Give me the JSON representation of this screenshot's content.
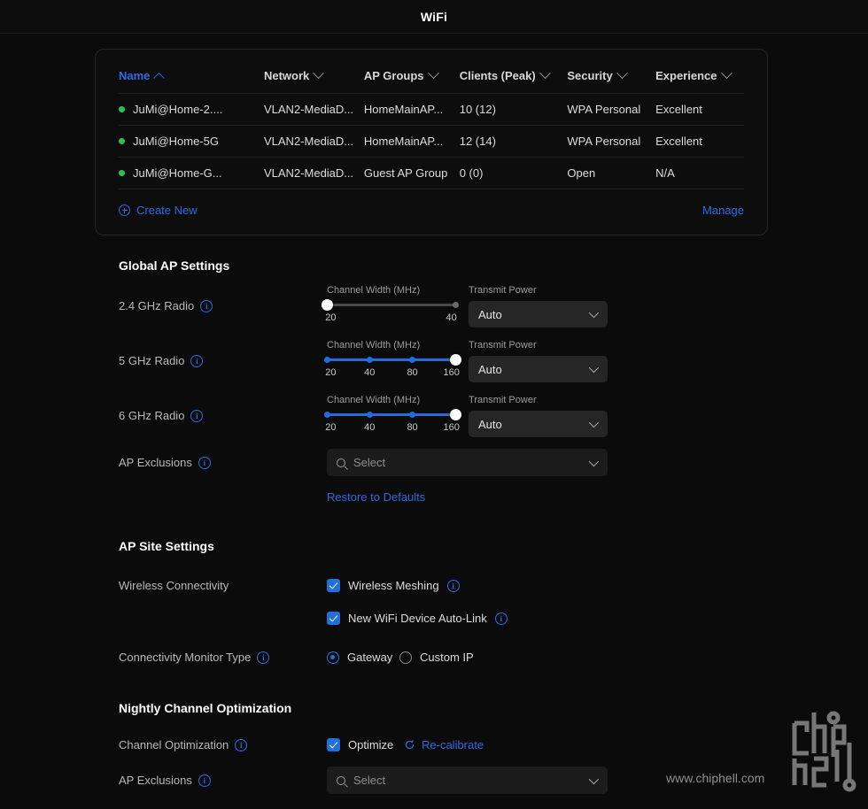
{
  "header": {
    "title": "WiFi"
  },
  "colors": {
    "accent": "#2d6be4",
    "slider_active": "#1f6fdc",
    "status_dot": "#31c04e",
    "experience_good": "#24a244",
    "page_bg": "#0b0b0b",
    "card_bg": "#0d0d0d",
    "field_bg": "#262626"
  },
  "wifi_table": {
    "columns": [
      {
        "label": "Name",
        "sorted": true,
        "sort_dir": "asc"
      },
      {
        "label": "Network",
        "sorted": false,
        "sort_dir": "none"
      },
      {
        "label": "AP Groups",
        "sorted": false,
        "sort_dir": "none"
      },
      {
        "label": "Clients (Peak)",
        "sorted": false,
        "sort_dir": "none"
      },
      {
        "label": "Security",
        "sorted": false,
        "sort_dir": "none"
      },
      {
        "label": "Experience",
        "sorted": false,
        "sort_dir": "none"
      }
    ],
    "rows": [
      {
        "status": "online",
        "name": "JuMi@Home-2....",
        "network": "VLAN2-MediaD...",
        "ap_groups": "HomeMainAP...",
        "clients": "10 (12)",
        "security": "WPA Personal",
        "experience": "Excellent",
        "experience_good": true
      },
      {
        "status": "online",
        "name": "JuMi@Home-5G",
        "network": "VLAN2-MediaD...",
        "ap_groups": "HomeMainAP...",
        "clients": "12 (14)",
        "security": "WPA Personal",
        "experience": "Excellent",
        "experience_good": true
      },
      {
        "status": "online",
        "name": "JuMi@Home-G...",
        "network": "VLAN2-MediaD...",
        "ap_groups": "Guest AP Group",
        "clients": "0 (0)",
        "security": "Open",
        "experience": "N/A",
        "experience_good": false
      }
    ],
    "create_new_label": "Create New",
    "manage_label": "Manage"
  },
  "global_ap_settings": {
    "title": "Global AP Settings",
    "channel_width_label": "Channel Width (MHz)",
    "transmit_power_label": "Transmit Power",
    "radios": [
      {
        "label": "2.4 GHz Radio",
        "ticks": [
          "20",
          "40"
        ],
        "selected_index": 0,
        "selected_value": "20",
        "active": false,
        "transmit_power": "Auto"
      },
      {
        "label": "5 GHz Radio",
        "ticks": [
          "20",
          "40",
          "80",
          "160"
        ],
        "selected_index": 3,
        "selected_value": "160",
        "active": true,
        "transmit_power": "Auto"
      },
      {
        "label": "6 GHz Radio",
        "ticks": [
          "20",
          "40",
          "80",
          "160"
        ],
        "selected_index": 3,
        "selected_value": "160",
        "active": true,
        "transmit_power": "Auto"
      }
    ],
    "ap_exclusions_label": "AP Exclusions",
    "ap_exclusions_value": "Select",
    "restore_label": "Restore to Defaults"
  },
  "ap_site_settings": {
    "title": "AP Site Settings",
    "wireless_connectivity_label": "Wireless Connectivity",
    "wireless_meshing_label": "Wireless Meshing",
    "wireless_meshing_checked": true,
    "auto_link_label": "New WiFi Device Auto-Link",
    "auto_link_checked": true,
    "monitor_type_label": "Connectivity Monitor Type",
    "monitor_gateway_label": "Gateway",
    "monitor_custom_label": "Custom IP",
    "monitor_selected": "Gateway"
  },
  "nightly_channel_optimization": {
    "title": "Nightly Channel Optimization",
    "channel_optimization_label": "Channel Optimization",
    "optimize_label": "Optimize",
    "optimize_checked": true,
    "recalibrate_label": "Re-calibrate",
    "ap_exclusions_label": "AP Exclusions",
    "ap_exclusions_value": "Select"
  },
  "watermark": {
    "url_text": "www.chiphell.com"
  }
}
